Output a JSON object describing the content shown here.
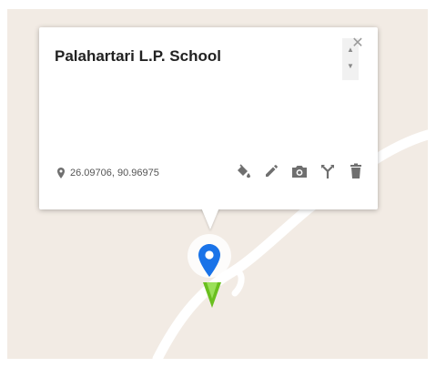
{
  "place": {
    "title": "Palahartari L.P. School",
    "coordinates": "26.09706, 90.96975"
  },
  "icons": {
    "location": "map-pin-icon",
    "style": "paint-bucket-icon",
    "edit": "pencil-icon",
    "photo": "camera-icon",
    "directions": "directions-fork-icon",
    "delete": "trash-icon",
    "close": "close-icon",
    "marker": "blue-map-marker-icon",
    "marker_secondary": "green-triangle-marker-icon"
  },
  "colors": {
    "map_background": "#f2ebe4",
    "road": "#ffffff",
    "marker_blue": "#1a73e8",
    "marker_green": "#6abf1f",
    "icon_gray": "#6f6f6f"
  }
}
